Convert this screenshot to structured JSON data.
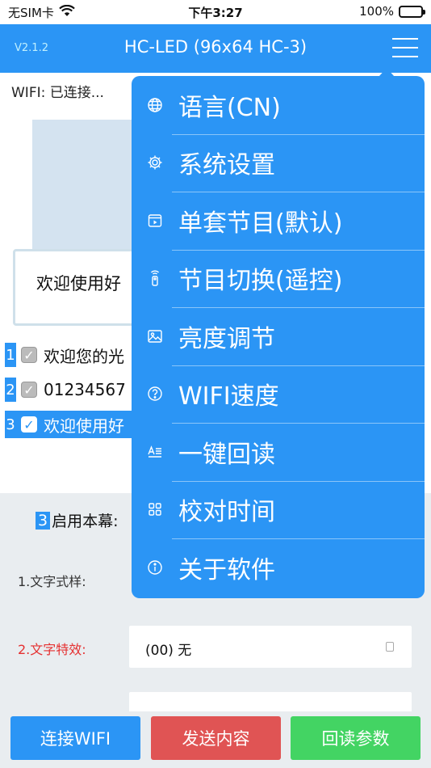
{
  "status_bar": {
    "carrier": "无SIM卡",
    "time": "下午3:27",
    "battery": "100%"
  },
  "header": {
    "version": "V2.1.2",
    "title": "HC-LED (96x64 HC-3)"
  },
  "content": {
    "wifi_status": "WIFI: 已连接...",
    "welcome_text": "欢迎使用好",
    "programs": [
      {
        "num": "1",
        "text": "欢迎您的光",
        "checked": true
      },
      {
        "num": "2",
        "text": "01234567",
        "checked": true
      },
      {
        "num": "3",
        "text": "欢迎使用好",
        "checked": true
      }
    ]
  },
  "form": {
    "enable_num": "3",
    "enable_label": "启用本幕:",
    "text_style_label": "1.文字式样:",
    "text_effect_label": "2.文字特效:",
    "text_effect_value": "(00) 无"
  },
  "menu": {
    "items": [
      {
        "label": "语言(CN)",
        "icon": "globe-icon"
      },
      {
        "label": "系统设置",
        "icon": "gear-icon"
      },
      {
        "label": "单套节目(默认)",
        "icon": "play-square-icon"
      },
      {
        "label": "节目切换(遥控)",
        "icon": "remote-icon"
      },
      {
        "label": "亮度调节",
        "icon": "image-icon"
      },
      {
        "label": "WIFI速度",
        "icon": "question-icon"
      },
      {
        "label": "一键回读",
        "icon": "text-format-icon"
      },
      {
        "label": "校对时间",
        "icon": "grid-icon"
      },
      {
        "label": "关于软件",
        "icon": "info-icon"
      }
    ]
  },
  "buttons": {
    "connect_wifi": "连接WIFI",
    "send_content": "发送内容",
    "read_params": "回读参数"
  },
  "colors": {
    "primary": "#2b95f5",
    "danger": "#e05454",
    "success": "#43d463"
  }
}
